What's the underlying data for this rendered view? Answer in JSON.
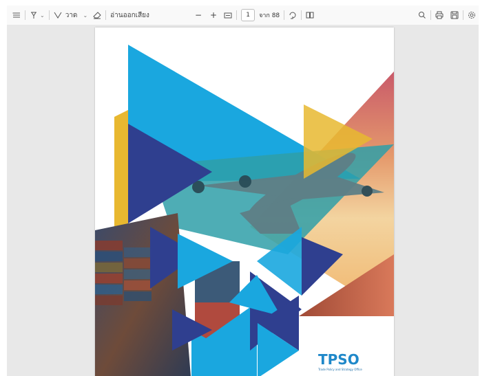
{
  "toolbar": {
    "draw_label": "วาด",
    "read_aloud_label": "อ่านออกเสียง",
    "zoom_out": "−",
    "zoom_in": "+",
    "page_current": "1",
    "page_total": "จาก 88"
  },
  "icons": [
    "contents-icon",
    "highlight-icon",
    "draw-icon",
    "eraser-icon",
    "fit-page-icon",
    "rotate-icon",
    "page-view-icon",
    "search-icon",
    "print-icon",
    "save-icon",
    "settings-icon"
  ],
  "document": {
    "logo_text": "TPSO",
    "logo_subtext": "Trade Policy and Strategy Office"
  },
  "colors": {
    "toolbar_bg": "#f9f9f9",
    "viewer_bg": "#e8e8e8",
    "accent_blue": "#1aa7df",
    "navy": "#2f3f8f",
    "yellow": "#e8b830"
  }
}
